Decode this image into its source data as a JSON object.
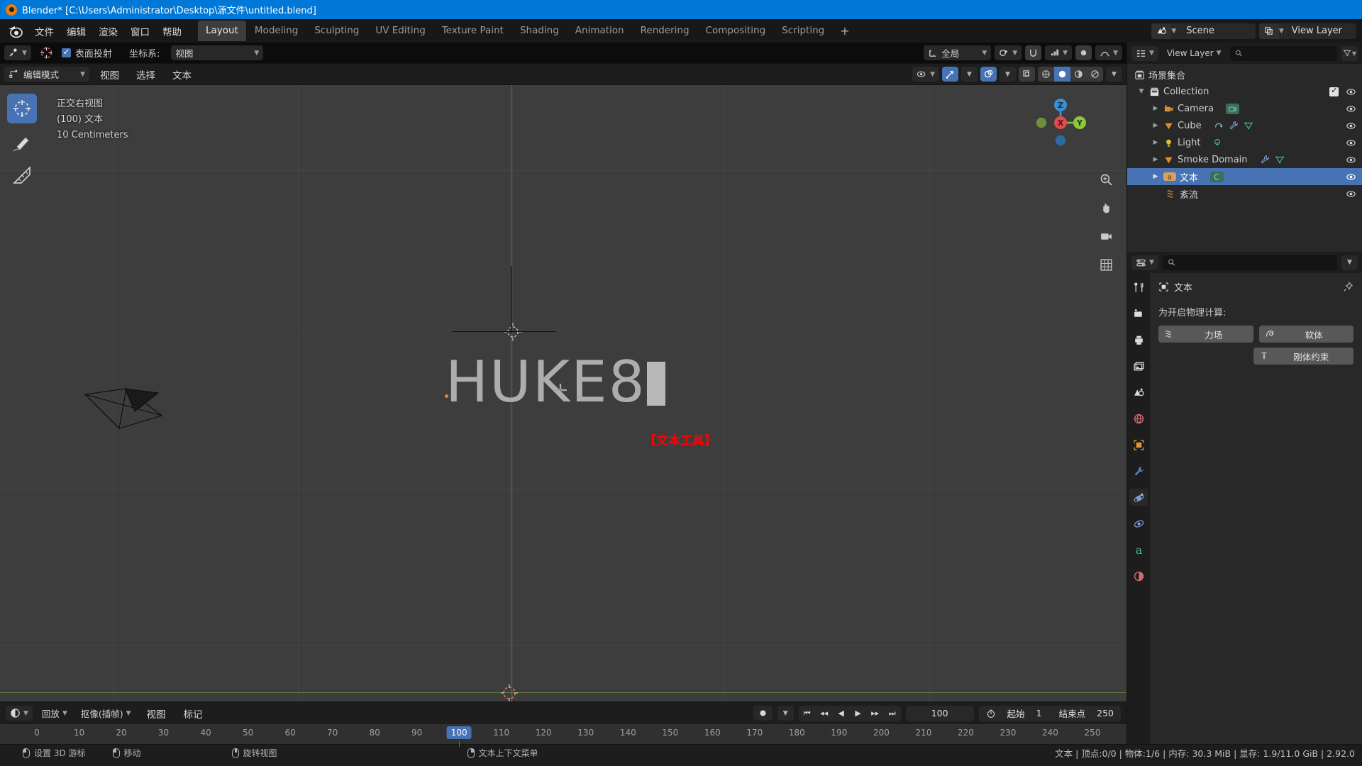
{
  "titlebar": {
    "text": "Blender* [C:\\Users\\Administrator\\Desktop\\源文件\\untitled.blend]",
    "icon": "blender-icon"
  },
  "topbar": {
    "menus": [
      "文件",
      "编辑",
      "渲染",
      "窗口",
      "帮助"
    ],
    "workspaces": [
      "Layout",
      "Modeling",
      "Sculpting",
      "UV Editing",
      "Texture Paint",
      "Shading",
      "Animation",
      "Rendering",
      "Compositing",
      "Scripting"
    ],
    "active_workspace": "Layout",
    "add_tab": "+",
    "scene_name": "Scene",
    "view_layer_name": "View Layer"
  },
  "tool_header": {
    "surface_project_label": "表面投射",
    "surface_project_checked": true,
    "orientation_label": "坐标系:",
    "orientation_value": "视图",
    "transform_orientation": "全局"
  },
  "viewport_header": {
    "mode": "编辑模式",
    "menus": [
      "视图",
      "选择",
      "文本"
    ]
  },
  "viewport": {
    "overlay_lines": [
      "正交右视图",
      "(100) 文本",
      "10 Centimeters"
    ],
    "text_object_value": "HUKE8",
    "annotation": "【文本工具】",
    "gizmo_axes": [
      "Z",
      "X",
      "Y"
    ],
    "accent_color": "#4772b3",
    "annotation_color": "#ff0000"
  },
  "outliner": {
    "header_filter_placeholder": "",
    "scene_collection_label": "场景集合",
    "rows": [
      {
        "label": "Collection",
        "icon": "collection-icon",
        "indent": 1,
        "selected": false,
        "checkbox": true,
        "eye": true,
        "extras": []
      },
      {
        "label": "Camera",
        "icon": "camera-icon",
        "indent": 2,
        "selected": false,
        "checkbox": false,
        "eye": true,
        "extras": [
          "camera-data-icon"
        ]
      },
      {
        "label": "Cube",
        "icon": "mesh-icon",
        "indent": 2,
        "selected": false,
        "checkbox": false,
        "eye": true,
        "extras": [
          "modifier-icon",
          "wrench-icon",
          "mesh-data-icon"
        ]
      },
      {
        "label": "Light",
        "icon": "light-icon",
        "indent": 2,
        "selected": false,
        "checkbox": false,
        "eye": true,
        "extras": [
          "light-data-icon"
        ]
      },
      {
        "label": "Smoke Domain",
        "icon": "mesh-icon",
        "indent": 2,
        "selected": false,
        "checkbox": false,
        "eye": true,
        "extras": [
          "wrench-icon",
          "mesh-data-icon"
        ]
      },
      {
        "label": "文本",
        "icon": "font-icon",
        "indent": 2,
        "selected": true,
        "checkbox": false,
        "eye": true,
        "extras": [
          "curve-data-icon"
        ]
      },
      {
        "label": "紊流",
        "icon": "force-field-icon",
        "indent": 3,
        "selected": false,
        "checkbox": false,
        "eye": true,
        "extras": []
      }
    ]
  },
  "properties": {
    "search_placeholder": "",
    "breadcrumb_object": "文本",
    "physics_label": "为开启物理计算:",
    "buttons": [
      {
        "label": "力场",
        "icon": "force-field-icon"
      },
      {
        "label": "软体",
        "icon": "soft-body-icon"
      },
      {
        "label": "刚体约束",
        "icon": "rigid-body-constraint-icon"
      }
    ],
    "tabs": [
      "tool-icon",
      "render-icon",
      "output-icon",
      "view-layer-icon",
      "scene-icon",
      "world-icon",
      "object-icon",
      "modifier-icon",
      "physics-icon",
      "constraint-icon",
      "data-icon",
      "material-icon"
    ]
  },
  "timeline": {
    "menus": [
      "回放",
      "抠像(插帧)",
      "视图",
      "标记"
    ],
    "keying_value": "抠像(插帧)",
    "playback_value": "回放",
    "current_frame": "100",
    "start_label": "起始",
    "start_value": "1",
    "end_label": "结束点",
    "end_value": "250",
    "ticks": [
      "0",
      "10",
      "20",
      "30",
      "40",
      "50",
      "60",
      "70",
      "80",
      "90",
      "100",
      "110",
      "120",
      "130",
      "140",
      "150",
      "160",
      "170",
      "180",
      "190",
      "200",
      "210",
      "220",
      "230",
      "240",
      "250"
    ],
    "playhead_frame": "100"
  },
  "statusbar": {
    "hints": [
      {
        "mouse": "left",
        "label": "设置 3D 游标"
      },
      {
        "mouse": "left",
        "label": "移动"
      },
      {
        "mouse": "middle",
        "label": "旋转视图"
      },
      {
        "mouse": "right",
        "label": "文本上下文菜单"
      }
    ],
    "stats": "文本 | 顶点:0/0 | 物体:1/6 | 内存: 30.3 MiB | 显存: 1.9/11.0 GiB | 2.92.0"
  }
}
